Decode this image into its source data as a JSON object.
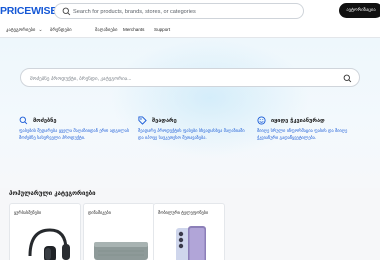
{
  "header": {
    "logo": "PRICEWISE",
    "search_placeholder": "Search for products, brands, stores, or categories",
    "signin_label": "ავტორიზაცია"
  },
  "nav": {
    "items": [
      {
        "label": "კატეგორიები",
        "has_dropdown": true
      },
      {
        "label": "ბრენდები"
      },
      {
        "label": "მაღაზიები"
      },
      {
        "label": "Merchants"
      },
      {
        "label": "Support"
      }
    ]
  },
  "hero": {
    "search_placeholder": "მოძებნე პროდუქტი, ბრენდი, კატეგორია...",
    "features": [
      {
        "icon": "search-icon",
        "title": "მოძებნე",
        "description": "ფასების შედარება ყველა მაღაზიიდან ერთ ადგილას მოძებნე სასურველი პროდუქტი."
      },
      {
        "icon": "tag-icon",
        "title": "შეადარე",
        "description": "შეადარე პროდუქტის ფასები სხვადასხვა მაღაზიაში და იპოვე საუკეთესო შეთავაზება."
      },
      {
        "icon": "smile-icon",
        "title": "იყიდე ჭკვიანურად",
        "description": "მიიღე სრული ინფორმაცია ფასის და მიიღე ჭკვიანური გადაწყვეტილება."
      }
    ]
  },
  "popular": {
    "title": "პოპულარული კატეგორიები",
    "cards": [
      {
        "label": "ყურსასმენები",
        "image": "headphones"
      },
      {
        "label": "დინამიკები",
        "image": "speaker"
      },
      {
        "label": "მობილური ტელეფონები",
        "image": "smartphone"
      }
    ]
  },
  "colors": {
    "brand": "#1558d6",
    "signin_bg": "#111111",
    "hero_bg": "#eef7fc",
    "feature_text": "#1558d6"
  }
}
